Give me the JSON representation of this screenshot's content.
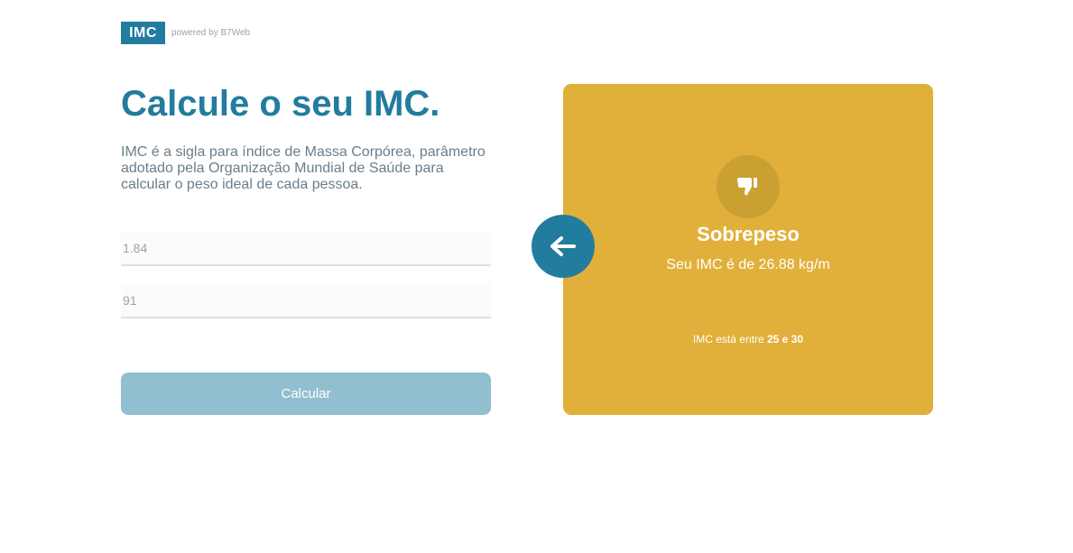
{
  "header": {
    "logo": "IMC",
    "powered_by": "powered by B7Web"
  },
  "main": {
    "title": "Calcule o seu IMC.",
    "description": "IMC é a sigla para índice de Massa Corpórea, parâmetro adotado pela Organização Mundial de Saúde para calcular o peso ideal de cada pessoa.",
    "height_value": "1.84",
    "weight_value": "91",
    "calculate_label": "Calcular"
  },
  "result": {
    "title": "Sobrepeso",
    "value_text": "Seu IMC é de 26.88 kg/m",
    "range_prefix": "IMC está entre",
    "range_min": "25",
    "range_and": "e",
    "range_max": "30",
    "color": "#e1b03a",
    "icon": "thumbs-down-icon"
  },
  "back_button": {
    "icon": "arrow-left-icon"
  },
  "colors": {
    "primary": "#227c9d",
    "button_disabled": "#91bfcf"
  }
}
